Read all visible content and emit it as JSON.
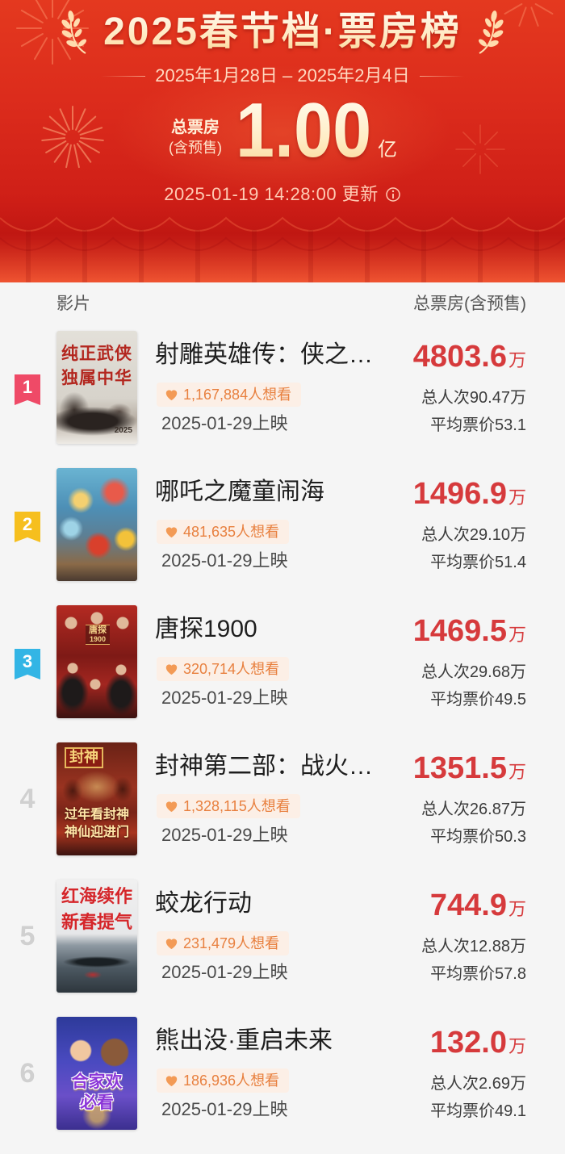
{
  "header": {
    "title": "2025春节档·票房榜",
    "date_range": "2025年1月28日 – 2025年2月4日",
    "total_label": "总票房",
    "total_sublabel": "(含预售)",
    "total_value": "1.00",
    "total_unit": "亿",
    "updated": "2025-01-19 14:28:00 更新",
    "icons": [
      "laurel-icon",
      "firework-icon",
      "info-icon"
    ]
  },
  "table": {
    "col_film": "影片",
    "col_box_office": "总票房(含预售)"
  },
  "colors": {
    "header_red": "#dc2c1c",
    "box_office_red": "#d63a3c",
    "want_text": "#e8803f",
    "want_bg": "#fcefe6",
    "rank_plain": "#d0d0d0"
  },
  "movies": [
    {
      "rank": "1",
      "badge_color": "#ef4a67",
      "title": "射雕英雄传：侠之…",
      "want": "1,167,884人想看",
      "release": "2025-01-29上映",
      "box_office": "4803.6",
      "unit": "万",
      "admissions": "总人次90.47万",
      "avg_price": "平均票价53.1",
      "poster": {
        "lines": [
          "纯正武侠",
          "独属中华",
          "2025"
        ]
      }
    },
    {
      "rank": "2",
      "badge_color": "#f6bf1e",
      "title": "哪吒之魔童闹海",
      "want": "481,635人想看",
      "release": "2025-01-29上映",
      "box_office": "1496.9",
      "unit": "万",
      "admissions": "总人次29.10万",
      "avg_price": "平均票价51.4",
      "poster": {
        "lines": []
      }
    },
    {
      "rank": "3",
      "badge_color": "#33b5e5",
      "title": "唐探1900",
      "want": "320,714人想看",
      "release": "2025-01-29上映",
      "box_office": "1469.5",
      "unit": "万",
      "admissions": "总人次29.68万",
      "avg_price": "平均票价49.5",
      "poster": {
        "lines": [
          "唐探",
          "1900"
        ]
      }
    },
    {
      "rank": "4",
      "badge_color": null,
      "title": "封神第二部：战火…",
      "want": "1,328,115人想看",
      "release": "2025-01-29上映",
      "box_office": "1351.5",
      "unit": "万",
      "admissions": "总人次26.87万",
      "avg_price": "平均票价50.3",
      "poster": {
        "lines": [
          "封神",
          "过年看封神",
          "神仙迎进门"
        ]
      }
    },
    {
      "rank": "5",
      "badge_color": null,
      "title": "蛟龙行动",
      "want": "231,479人想看",
      "release": "2025-01-29上映",
      "box_office": "744.9",
      "unit": "万",
      "admissions": "总人次12.88万",
      "avg_price": "平均票价57.8",
      "poster": {
        "lines": [
          "红海续作",
          "新春提气"
        ]
      }
    },
    {
      "rank": "6",
      "badge_color": null,
      "title": "熊出没·重启未来",
      "want": "186,936人想看",
      "release": "2025-01-29上映",
      "box_office": "132.0",
      "unit": "万",
      "admissions": "总人次2.69万",
      "avg_price": "平均票价49.1",
      "poster": {
        "lines": [
          "合家欢",
          "必看"
        ]
      }
    }
  ]
}
